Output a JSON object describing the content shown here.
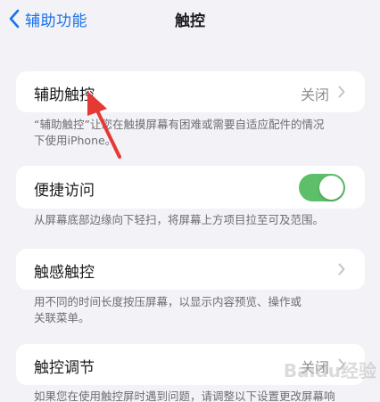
{
  "nav": {
    "back_label": "辅助功能",
    "title": "触控"
  },
  "sections": [
    {
      "label": "辅助触控",
      "value": "关闭",
      "footer_lines": [
        "“辅助触控”让您在触摸屏幕有困难或需要自适应配件的情况",
        "下使用iPhone。"
      ]
    },
    {
      "label": "便捷访问",
      "toggle_on": true,
      "footer_lines": [
        "从屏幕底部边缘向下轻扫，将屏幕上方项目拉至可及范围。"
      ]
    },
    {
      "label": "触感触控",
      "footer_lines": [
        "用不同的时间长度按压屏幕，以显示内容预览、操作或",
        "关联菜单。"
      ]
    },
    {
      "label": "触控调节",
      "value": "关闭",
      "footer_lines": [
        "如果您在使用触控屏时遇到问题，请调整以下设置更改屏幕响"
      ]
    }
  ],
  "watermark_text": "Baidu经验",
  "colors": {
    "accent": "#1a73e8",
    "toggle_on": "#5ebf6b",
    "background": "#f2f2f7",
    "annotation": "#e53935"
  }
}
